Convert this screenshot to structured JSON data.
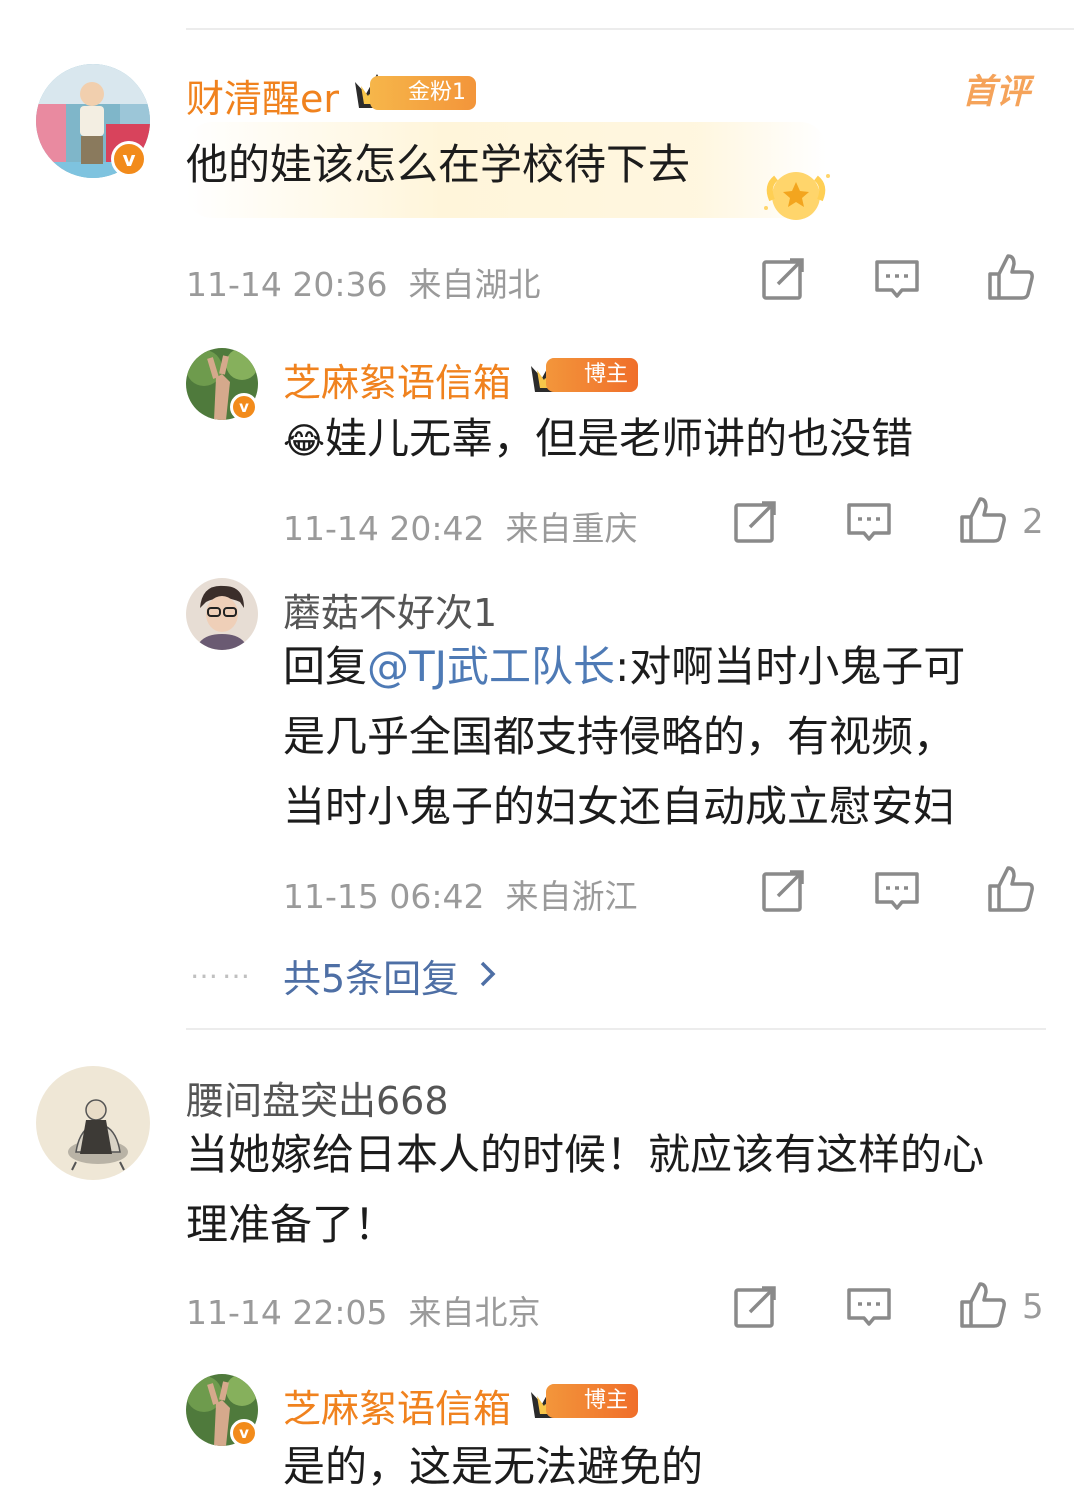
{
  "comments": [
    {
      "user": "财清醒er",
      "badge": "金粉1",
      "corner_badge": "首评",
      "text": "他的娃该怎么在学校待下去",
      "time": "11-14 20:36",
      "location": "来自湖北",
      "likes": "",
      "replies": [
        {
          "user": "芝麻絮语信箱",
          "badge": "博主",
          "emoji": "😂",
          "text": "娃儿无辜，但是老师讲的也没错",
          "time": "11-14 20:42",
          "location": "来自重庆",
          "likes": "2"
        },
        {
          "user": "蘑菇不好次1",
          "reply_prefix": "回复",
          "mention": "@TJ武工队长",
          "line1_rest": ":对啊当时小鬼子可",
          "line2": "是几乎全国都支持侵略的，有视频，",
          "line3": "当时小鬼子的妇女还自动成立慰安妇",
          "time": "11-15 06:42",
          "location": "来自浙江",
          "likes": ""
        }
      ],
      "more_replies": "共5条回复",
      "ellipsis": "……"
    },
    {
      "user": "腰间盘突出668",
      "text_line1": "当她嫁给日本人的时候！就应该有这样的心",
      "text_line2": "理准备了！",
      "time": "11-14 22:05",
      "location": "来自北京",
      "likes": "5",
      "replies": [
        {
          "user": "芝麻絮语信箱",
          "badge": "博主",
          "text": "是的，这是无法避免的"
        }
      ]
    }
  ],
  "icons": [
    "repost-icon",
    "comment-icon",
    "like-icon",
    "crown-icon",
    "verified-v-icon",
    "chevron-right-icon",
    "medal-icon"
  ],
  "colors": {
    "gold_name": "#f0821e",
    "link": "#4e7ab5",
    "meta": "#9a9a9a",
    "badge_orange": "#f28b1b"
  }
}
